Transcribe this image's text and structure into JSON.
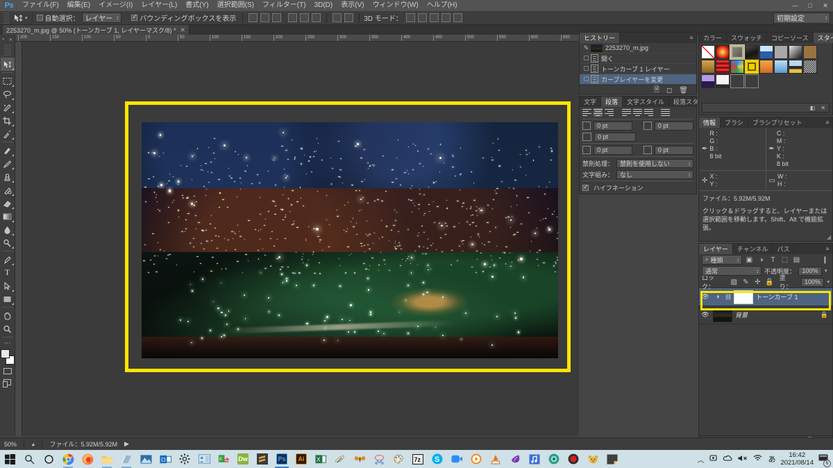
{
  "app": {
    "logo": "Ps",
    "menu": [
      "ファイル(F)",
      "編集(E)",
      "イメージ(I)",
      "レイヤー(L)",
      "書式(Y)",
      "選択範囲(S)",
      "フィルター(T)",
      "3D(D)",
      "表示(V)",
      "ウィンドウ(W)",
      "ヘルプ(H)"
    ],
    "window_controls": [
      "—",
      "□",
      "✕"
    ]
  },
  "options_bar": {
    "auto_select_label": "自動選択：",
    "auto_select_value": "レイヤー",
    "show_bounding_box_label": "バウンディングボックスを表示",
    "mode_3d_label": "3D モード：",
    "workspace": "初期設定"
  },
  "document_tab": {
    "title": "2253270_m.jpg @ 50% (トーンカーブ 1, レイヤーマスク/8) *",
    "close": "✕"
  },
  "rulers": {
    "h_ticks": [
      "200",
      "150",
      "100",
      "50",
      "0",
      "50",
      "100",
      "150",
      "200",
      "250",
      "300",
      "350",
      "400",
      "450",
      "500",
      "550",
      "600",
      "650"
    ],
    "v_ticks": [
      "150",
      "100",
      "50",
      "0",
      "50",
      "100",
      "150",
      "200",
      "250",
      "300",
      "350"
    ]
  },
  "toolbar": {
    "tools": [
      {
        "name": "move-tool",
        "glyph": "✛",
        "selected": true
      },
      {
        "name": "rectangular-marquee-tool",
        "glyph": "▭",
        "selected": false
      },
      {
        "name": "lasso-tool",
        "glyph": "◌",
        "selected": false
      },
      {
        "name": "quick-selection-tool",
        "glyph": "✎",
        "selected": false
      },
      {
        "name": "crop-tool",
        "glyph": "⌗",
        "selected": false
      },
      {
        "name": "eyedropper-tool",
        "glyph": "✒",
        "selected": false
      },
      {
        "name": "spot-healing-brush-tool",
        "glyph": "✂",
        "selected": false
      },
      {
        "name": "brush-tool",
        "glyph": "🖌",
        "selected": false
      },
      {
        "name": "clone-stamp-tool",
        "glyph": "⚒",
        "selected": false
      },
      {
        "name": "history-brush-tool",
        "glyph": "✧",
        "selected": false
      },
      {
        "name": "eraser-tool",
        "glyph": "◨",
        "selected": false
      },
      {
        "name": "gradient-tool",
        "glyph": "▤",
        "selected": false
      },
      {
        "name": "blur-tool",
        "glyph": "💧",
        "selected": false
      },
      {
        "name": "dodge-tool",
        "glyph": "◑",
        "selected": false
      },
      {
        "name": "pen-tool",
        "glyph": "✐",
        "selected": false
      },
      {
        "name": "type-tool",
        "glyph": "T",
        "selected": false
      },
      {
        "name": "path-selection-tool",
        "glyph": "↖",
        "selected": false
      },
      {
        "name": "rectangle-tool",
        "glyph": "▢",
        "selected": false
      },
      {
        "name": "hand-tool",
        "glyph": "✋",
        "selected": false
      },
      {
        "name": "zoom-tool",
        "glyph": "🔍",
        "selected": false
      }
    ]
  },
  "history_panel": {
    "tabs": [
      {
        "label": "ヒストリー",
        "active": true
      }
    ],
    "items": [
      {
        "label": "2253270_m.jpg",
        "type": "snapshot",
        "selected": false
      },
      {
        "label": "開く",
        "type": "state",
        "selected": false
      },
      {
        "label": "トーンカーブ 1 レイヤー",
        "type": "state",
        "selected": false
      },
      {
        "label": "カーブレイヤーを変更",
        "type": "state",
        "selected": true
      }
    ],
    "footer_icons": [
      "create-document-icon",
      "create-snapshot-icon",
      "delete-icon"
    ]
  },
  "paragraph_panel": {
    "tabs": [
      {
        "label": "文字",
        "active": false
      },
      {
        "label": "段落",
        "active": true
      },
      {
        "label": "文字スタイル",
        "active": false
      },
      {
        "label": "段落スタイル",
        "active": false
      }
    ],
    "fields": [
      {
        "name": "indent-left",
        "value": "0 pt"
      },
      {
        "name": "indent-right",
        "value": "0 pt"
      },
      {
        "name": "indent-first-line",
        "value": "0 pt"
      },
      {
        "name": "space-before",
        "value": "0 pt"
      },
      {
        "name": "space-after",
        "value": "0 pt"
      }
    ],
    "kinsoku_label": "禁則処理：",
    "kinsoku_value": "禁則を使用しない",
    "mojikumi_label": "文字組み：",
    "mojikumi_value": "なし",
    "hyphenation_label": "ハイフネーション"
  },
  "styles_panel": {
    "tabs": [
      {
        "label": "カラー",
        "active": false
      },
      {
        "label": "スウォッチ",
        "active": false
      },
      {
        "label": "コピーソース",
        "active": false
      },
      {
        "label": "スタイル",
        "active": true
      }
    ],
    "swatches": [
      {
        "name": "none-style",
        "selected": false
      },
      {
        "name": "red-glow-style",
        "selected": false
      },
      {
        "name": "bevel-style",
        "selected": true
      },
      {
        "name": "dark-texture-style",
        "selected": false
      },
      {
        "name": "blue-gloss-style",
        "selected": false
      },
      {
        "name": "gray-flat-style",
        "selected": false
      },
      {
        "name": "black-gradient-style",
        "selected": false
      },
      {
        "name": "brown-style",
        "selected": false
      },
      {
        "name": "tan-style",
        "selected": false
      },
      {
        "name": "red-stripe-style",
        "selected": false
      },
      {
        "name": "colorful-style",
        "selected": false
      },
      {
        "name": "yellow-box-style",
        "selected": false
      },
      {
        "name": "sunset-style",
        "selected": false
      },
      {
        "name": "sky-style",
        "selected": false
      },
      {
        "name": "horizon-style",
        "selected": false
      },
      {
        "name": "noise-style",
        "selected": false
      },
      {
        "name": "purple-style",
        "selected": false
      },
      {
        "name": "white-fade-style",
        "selected": false
      },
      {
        "name": "empty-style-1",
        "selected": false
      },
      {
        "name": "empty-style-2",
        "selected": false
      }
    ]
  },
  "info_panel": {
    "tabs": [
      {
        "label": "情報",
        "active": true
      },
      {
        "label": "ブラシ",
        "active": false
      },
      {
        "label": "ブラシプリセット",
        "active": false
      }
    ],
    "rgb": [
      "R :",
      "G :",
      "B :"
    ],
    "rgb_depth": "8 bit",
    "cmyk": [
      "C :",
      "M :",
      "Y :",
      "K :"
    ],
    "cmyk_depth": "8 bit",
    "xy": [
      "X :",
      "Y :"
    ],
    "wh": [
      "W :",
      "H :"
    ],
    "file_label": "ファイル：5.92M/5.92M",
    "hint": "クリック＆ドラッグすると、レイヤーまたは選択範囲を移動します。Shift、Alt で機能拡張。"
  },
  "layers_panel": {
    "tabs": [
      {
        "label": "レイヤー",
        "active": true
      },
      {
        "label": "チャンネル",
        "active": false
      },
      {
        "label": "パス",
        "active": false
      }
    ],
    "filter_value": "種類",
    "filter_icons": [
      "pixel-filter-icon",
      "adjustment-filter-icon",
      "type-filter-icon",
      "shape-filter-icon",
      "smart-object-filter-icon"
    ],
    "blend_mode": "通常",
    "opacity_label": "不透明度：",
    "opacity_value": "100%",
    "lock_label": "ロック：",
    "lock_icons": [
      "lock-transparent-icon",
      "lock-image-icon",
      "lock-position-icon",
      "lock-all-icon"
    ],
    "fill_label": "塗り：",
    "fill_value": "100%",
    "layers": [
      {
        "name": "トーンカーブ 1",
        "type": "adjustment",
        "selected": true,
        "visible": true,
        "locked": false
      },
      {
        "name": "背景",
        "type": "image",
        "selected": false,
        "visible": true,
        "locked": true
      }
    ],
    "footer_icons": [
      "link-icon",
      "fx-icon",
      "mask-icon",
      "adjustment-icon",
      "group-icon",
      "new-layer-icon",
      "delete-layer-icon"
    ]
  },
  "status_bar": {
    "zoom": "50%",
    "file_info": "ファイル：5.92M/5.92M",
    "arrow": "▶"
  },
  "taskbar": {
    "items": [
      {
        "name": "start-button",
        "glyph": "⊞",
        "color": "#1b1b1b",
        "state": ""
      },
      {
        "name": "search-icon",
        "glyph": "🔍",
        "color": "#1b1b1b",
        "state": ""
      },
      {
        "name": "cortana-icon",
        "glyph": "◯",
        "color": "#1b1b1b",
        "state": ""
      },
      {
        "name": "chrome-icon",
        "glyph": "C",
        "color": "#4fa04f",
        "state": "running"
      },
      {
        "name": "firefox-icon",
        "glyph": "F",
        "color": "#e8663a",
        "state": ""
      },
      {
        "name": "file-explorer-icon",
        "glyph": "▤",
        "color": "#e8b13a",
        "state": "running"
      },
      {
        "name": "notepad-icon",
        "glyph": "▧",
        "color": "#8fa7bb",
        "state": "running"
      },
      {
        "name": "photos-icon",
        "glyph": "▲",
        "color": "#2a5b8c",
        "state": ""
      },
      {
        "name": "outlook-icon",
        "glyph": "O",
        "color": "#2a5b9c",
        "state": ""
      },
      {
        "name": "settings-icon",
        "glyph": "⚙",
        "color": "#3a3a3a",
        "state": ""
      },
      {
        "name": "contacts-icon",
        "glyph": "▤",
        "color": "#6fa3cc",
        "state": ""
      },
      {
        "name": "ffftp-icon",
        "glyph": "F",
        "color": "#3f9f3f",
        "state": ""
      },
      {
        "name": "dreamweaver-icon",
        "glyph": "Dw",
        "color": "#7a9b2a",
        "state": ""
      },
      {
        "name": "sublime-icon",
        "glyph": "S",
        "color": "#e8a33a",
        "state": ""
      },
      {
        "name": "photoshop-icon",
        "glyph": "Ps",
        "color": "#3fa9f5",
        "state": "active"
      },
      {
        "name": "illustrator-icon",
        "glyph": "Ai",
        "color": "#f08a24",
        "state": ""
      },
      {
        "name": "excel-icon",
        "glyph": "X",
        "color": "#1f7244",
        "state": ""
      },
      {
        "name": "paint-icon",
        "glyph": "✎",
        "color": "#d8d8a0",
        "state": ""
      },
      {
        "name": "butterfly-icon",
        "glyph": "🦋",
        "color": "#d4742a",
        "state": ""
      },
      {
        "name": "snipping-tool-icon",
        "glyph": "✂",
        "color": "#c86a6a",
        "state": ""
      },
      {
        "name": "paint-palette-icon",
        "glyph": "🎨",
        "color": "#b07ab0",
        "state": ""
      },
      {
        "name": "sevenzip-icon",
        "glyph": "7z",
        "color": "#2b2b2b",
        "state": ""
      },
      {
        "name": "skype-icon",
        "glyph": "S",
        "color": "#0aa2e8",
        "state": ""
      },
      {
        "name": "zoom-app-icon",
        "glyph": "▶",
        "color": "#2d8cff",
        "state": ""
      },
      {
        "name": "media-player-icon",
        "glyph": "▶",
        "color": "#e8721a",
        "state": ""
      },
      {
        "name": "vlc-icon",
        "glyph": "▲",
        "color": "#e8721a",
        "state": ""
      },
      {
        "name": "inkscape-icon",
        "glyph": "✦",
        "color": "#7a3ab0",
        "state": ""
      },
      {
        "name": "music-icon",
        "glyph": "♪",
        "color": "#3a6fd8",
        "state": ""
      },
      {
        "name": "disc-icon",
        "glyph": "◉",
        "color": "#2a9a8a",
        "state": ""
      },
      {
        "name": "record-icon",
        "glyph": "⬤",
        "color": "#c81e1e",
        "state": ""
      },
      {
        "name": "bear-icon",
        "glyph": "◕",
        "color": "#d8a83a",
        "state": ""
      },
      {
        "name": "sticky-note-icon",
        "glyph": "▰",
        "color": "#4a4a4a",
        "state": ""
      }
    ],
    "tray": {
      "chevron": "︿",
      "icons": [
        "device-icon",
        "onedrive-icon",
        "volume-mute-icon",
        "wifi-icon"
      ],
      "ime": "あ",
      "time": "16:42",
      "date": "2021/08/14",
      "notification_count": "6"
    }
  },
  "photo": {
    "alt_name": "night-cityscape-photo",
    "description": "夜景写真"
  }
}
